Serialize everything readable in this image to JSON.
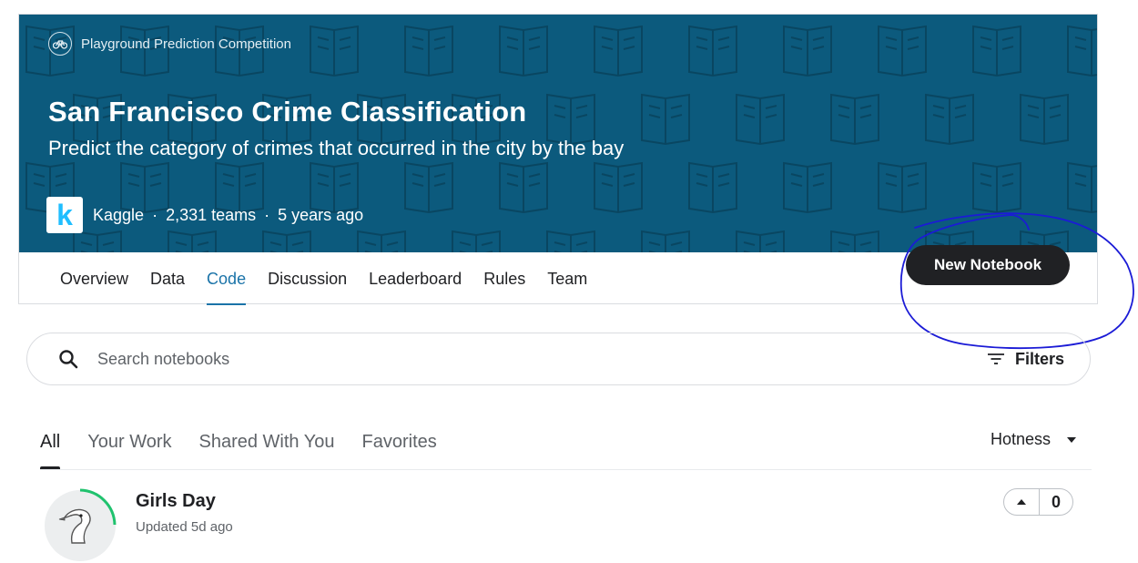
{
  "competition": {
    "type_label": "Playground Prediction Competition",
    "title": "San Francisco Crime Classification",
    "subtitle": "Predict the category of crimes that occurred in the city by the bay",
    "host_logo_letter": "k",
    "host": "Kaggle",
    "separator": "·",
    "teams": "2,331 teams",
    "age": "5 years ago",
    "banner_color": "#0c5a7d"
  },
  "nav": {
    "tabs": [
      {
        "label": "Overview"
      },
      {
        "label": "Data"
      },
      {
        "label": "Code"
      },
      {
        "label": "Discussion"
      },
      {
        "label": "Leaderboard"
      },
      {
        "label": "Rules"
      },
      {
        "label": "Team"
      }
    ],
    "active": "Code",
    "new_notebook_label": "New Notebook"
  },
  "search": {
    "placeholder": "Search notebooks",
    "value": "",
    "filters_label": "Filters"
  },
  "subtabs": {
    "items": [
      {
        "label": "All"
      },
      {
        "label": "Your Work"
      },
      {
        "label": "Shared With You"
      },
      {
        "label": "Favorites"
      }
    ],
    "active": "All",
    "sort_label": "Hotness"
  },
  "notebooks": [
    {
      "title": "Girls Day",
      "updated": "Updated 5d ago",
      "votes": "0"
    }
  ],
  "colors": {
    "accent": "#1a73a8",
    "annotation": "#1b1bd6",
    "progress_ring": "#20c26e"
  },
  "icons": [
    "bicycle-icon",
    "search-icon",
    "filter-icon",
    "caret-down-icon",
    "upvote-icon",
    "book-icon"
  ]
}
